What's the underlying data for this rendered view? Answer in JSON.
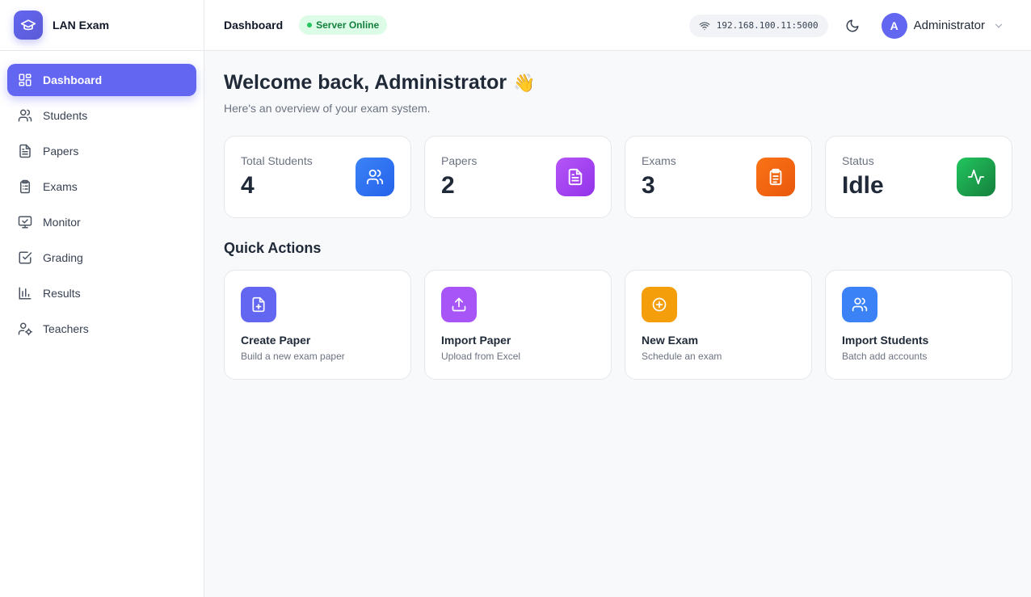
{
  "app": {
    "name": "LAN Exam",
    "logo_icon": "graduation-cap-icon"
  },
  "sidebar": {
    "items": [
      {
        "label": "Dashboard",
        "icon": "dashboard-icon",
        "active": true
      },
      {
        "label": "Students",
        "icon": "users-icon"
      },
      {
        "label": "Papers",
        "icon": "file-text-icon"
      },
      {
        "label": "Exams",
        "icon": "clipboard-list-icon"
      },
      {
        "label": "Monitor",
        "icon": "monitor-icon"
      },
      {
        "label": "Grading",
        "icon": "check-square-icon"
      },
      {
        "label": "Results",
        "icon": "bar-chart-icon"
      },
      {
        "label": "Teachers",
        "icon": "user-cog-icon"
      }
    ]
  },
  "header": {
    "title": "Dashboard",
    "server_status": "Server Online",
    "server_address": "192.168.100.11:5000",
    "user_initial": "A",
    "user_name": "Administrator"
  },
  "main": {
    "welcome": "Welcome back, Administrator",
    "welcome_emoji": "👋",
    "subtitle": "Here's an overview of your exam system.",
    "stats": [
      {
        "label": "Total Students",
        "value": "4",
        "icon": "users-icon",
        "color": "#3b82f6"
      },
      {
        "label": "Papers",
        "value": "2",
        "icon": "file-text-icon",
        "color": "#a855f7"
      },
      {
        "label": "Exams",
        "value": "3",
        "icon": "clipboard-icon",
        "color": "#f97316"
      },
      {
        "label": "Status",
        "value": "Idle",
        "icon": "activity-icon",
        "color": "#16a34a"
      }
    ],
    "quick_actions_title": "Quick Actions",
    "actions": [
      {
        "title": "Create Paper",
        "desc": "Build a new exam paper",
        "icon": "file-plus-icon",
        "color": "#6366f1"
      },
      {
        "title": "Import Paper",
        "desc": "Upload from Excel",
        "icon": "upload-icon",
        "color": "#a855f7"
      },
      {
        "title": "New Exam",
        "desc": "Schedule an exam",
        "icon": "plus-circle-icon",
        "color": "#f59e0b"
      },
      {
        "title": "Import Students",
        "desc": "Batch add accounts",
        "icon": "users-icon",
        "color": "#3b82f6"
      }
    ]
  },
  "colors": {
    "accent": "#6366f1",
    "online": "#22c55e",
    "background": "#f8f9fb"
  }
}
